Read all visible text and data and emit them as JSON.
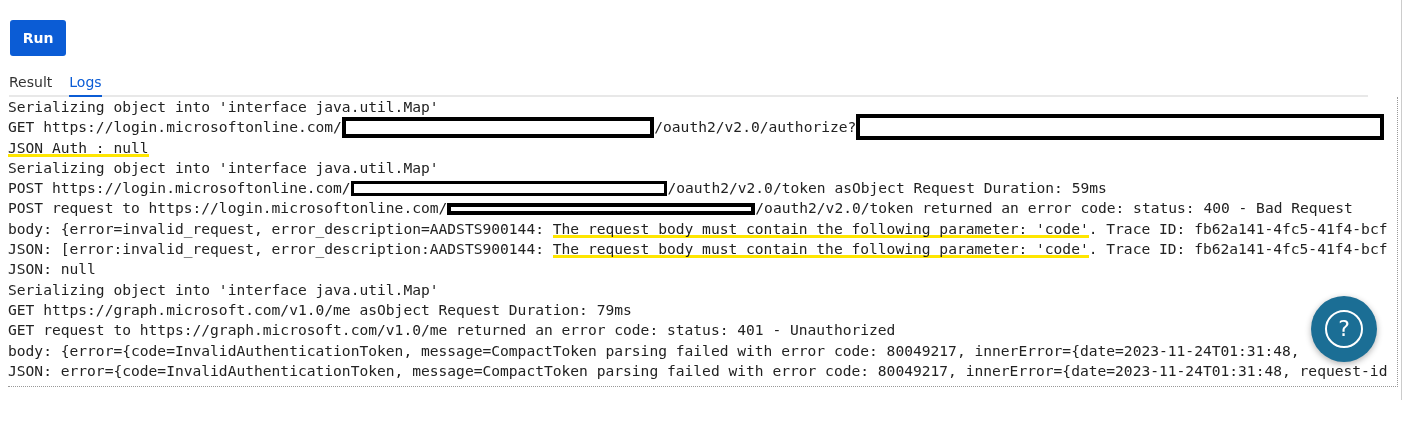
{
  "run_button": {
    "label": "Run"
  },
  "tabs": [
    {
      "label": "Result",
      "selected": false
    },
    {
      "label": "Logs",
      "selected": true
    }
  ],
  "log_lines": [
    {
      "segments": [
        {
          "kind": "text",
          "text": "Serializing object into 'interface java.util.Map'"
        }
      ]
    },
    {
      "segments": [
        {
          "kind": "text",
          "text": "GET https://login.microsoftonline.com/"
        },
        {
          "kind": "redacted"
        },
        {
          "kind": "text",
          "text": "/oauth2/v2.0/authorize?"
        },
        {
          "kind": "redacted"
        }
      ]
    },
    {
      "segments": [
        {
          "kind": "text",
          "text": "JSON Auth : null",
          "highlighted": true
        }
      ]
    },
    {
      "segments": [
        {
          "kind": "text",
          "text": "Serializing object into 'interface java.util.Map'"
        }
      ]
    },
    {
      "segments": [
        {
          "kind": "text",
          "text": "POST https://login.microsoftonline.com/"
        },
        {
          "kind": "redacted"
        },
        {
          "kind": "text",
          "text": "/oauth2/v2.0/token asObject Request Duration: 59ms"
        }
      ]
    },
    {
      "segments": [
        {
          "kind": "text",
          "text": "POST request to https://login.microsoftonline.com/"
        },
        {
          "kind": "redacted"
        },
        {
          "kind": "text",
          "text": "/oauth2/v2.0/token returned an error code: status: 400 - Bad Request"
        }
      ]
    },
    {
      "segments": [
        {
          "kind": "text",
          "text": "body: {error=invalid_request, error_description=AADSTS900144: "
        },
        {
          "kind": "text",
          "text": "The request body must contain the following parameter: 'code'",
          "highlighted": true
        },
        {
          "kind": "text",
          "text": ". Trace ID: fb62a141-4fc5-41f4-bcf"
        }
      ]
    },
    {
      "segments": [
        {
          "kind": "text",
          "text": "JSON: [error:invalid_request, error_description:AADSTS900144: "
        },
        {
          "kind": "text",
          "text": "The request body must contain the following parameter: 'code'",
          "highlighted": true
        },
        {
          "kind": "text",
          "text": ". Trace ID: fb62a141-4fc5-41f4-bcf"
        }
      ]
    },
    {
      "segments": [
        {
          "kind": "text",
          "text": "JSON: null"
        }
      ]
    },
    {
      "segments": [
        {
          "kind": "text",
          "text": "Serializing object into 'interface java.util.Map'"
        }
      ]
    },
    {
      "segments": [
        {
          "kind": "text",
          "text": "GET https://graph.microsoft.com/v1.0/me asObject Request Duration: 79ms"
        }
      ]
    },
    {
      "segments": [
        {
          "kind": "text",
          "text": "GET request to https://graph.microsoft.com/v1.0/me returned an error code: status: 401 - Unauthorized"
        }
      ]
    },
    {
      "segments": [
        {
          "kind": "text",
          "text": "body: {error={code=InvalidAuthenticationToken, message=CompactToken parsing failed with error code: 80049217, innerError={date=2023-11-24T01:31:48,"
        }
      ]
    },
    {
      "segments": [
        {
          "kind": "text",
          "text": "JSON: error={code=InvalidAuthenticationToken, message=CompactToken parsing failed with error code: 80049217, innerError={date=2023-11-24T01:31:48, request-id"
        }
      ]
    }
  ],
  "help_button": {
    "label": "?"
  }
}
